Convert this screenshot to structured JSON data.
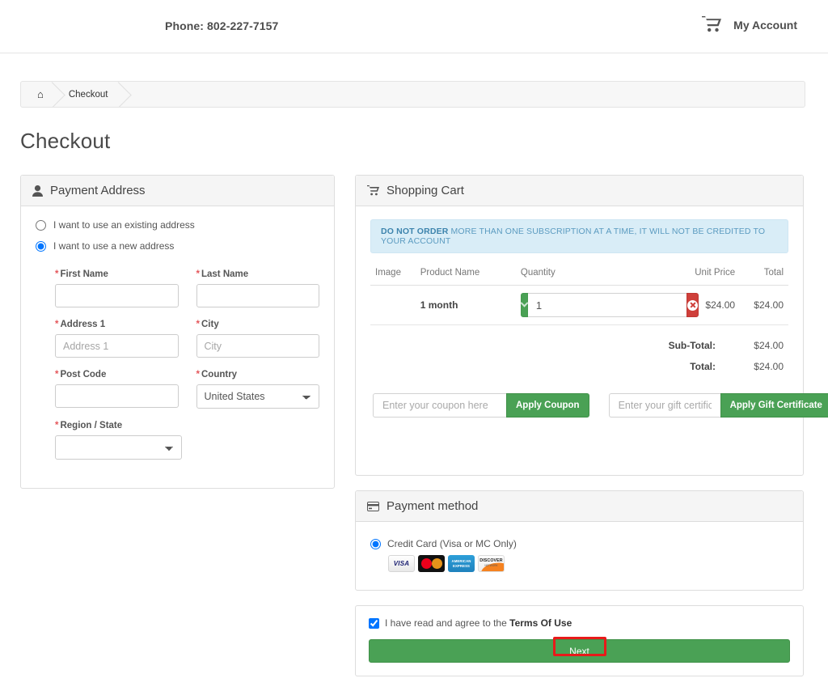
{
  "header": {
    "phone_label": "Phone: 802-227-7157",
    "cart_icon": "shopping-cart-icon",
    "my_account": "My Account"
  },
  "breadcrumb": {
    "home_icon": "home-icon",
    "items": [
      {
        "label": "Checkout"
      }
    ]
  },
  "page_title": "Checkout",
  "payment_address": {
    "panel_icon": "user-icon",
    "panel_title": "Payment Address",
    "options": [
      {
        "label": "I want to use an existing address",
        "selected": false
      },
      {
        "label": "I want to use a new address",
        "selected": true
      }
    ],
    "fields": {
      "first_name": {
        "label": "First Name",
        "required": "*",
        "value": "",
        "placeholder": ""
      },
      "last_name": {
        "label": "Last Name",
        "required": "*",
        "value": "",
        "placeholder": ""
      },
      "address_1": {
        "label": "Address 1",
        "required": "*",
        "value": "",
        "placeholder": "Address 1"
      },
      "city": {
        "label": "City",
        "required": "*",
        "value": "",
        "placeholder": "City"
      },
      "post_code": {
        "label": "Post Code",
        "required": "*",
        "value": "",
        "placeholder": ""
      },
      "country": {
        "label": "Country",
        "required": "*",
        "value": "United States"
      },
      "region_state": {
        "label": "Region / State",
        "required": "*",
        "value": ""
      }
    }
  },
  "shopping_cart": {
    "panel_icon": "cart-icon",
    "panel_title": "Shopping Cart",
    "notice": {
      "strong": "DO NOT ORDER",
      "rest": " MORE THAN ONE SUBSCRIPTION AT A TIME, IT WILL NOT BE CREDITED TO YOUR ACCOUNT"
    },
    "columns": [
      "Image",
      "Product Name",
      "Quantity",
      "Unit Price",
      "Total"
    ],
    "rows": [
      {
        "image": "",
        "product_name": "1 month",
        "quantity": "1",
        "qty_dropdown_icon": "chevron-down-icon",
        "remove_icon": "remove-circle-icon",
        "unit_price": "$24.00",
        "total": "$24.00"
      }
    ],
    "totals": [
      {
        "label": "Sub-Total:",
        "value": "$24.00"
      },
      {
        "label": "Total:",
        "value": "$24.00"
      }
    ],
    "coupon": {
      "placeholder": "Enter your coupon here",
      "value": "",
      "button": "Apply Coupon"
    },
    "gift_certificate": {
      "placeholder": "Enter your gift certificate here",
      "value": "",
      "button": "Apply Gift Certificate"
    }
  },
  "payment_method": {
    "panel_icon": "credit-card-icon",
    "panel_title": "Payment method",
    "options": [
      {
        "label": "Credit Card (Visa or MC Only)",
        "selected": true
      }
    ],
    "cards": [
      {
        "name": "visa-card-icon",
        "label": "VISA"
      },
      {
        "name": "mastercard-card-icon",
        "label": ""
      },
      {
        "name": "amex-card-icon",
        "label": "AMERICAN EXPRESS"
      },
      {
        "name": "discover-card-icon",
        "label": "DISCOVER",
        "sub": "NETWORK"
      }
    ]
  },
  "terms": {
    "checkbox_checked": true,
    "text_before": "I have read and agree to the ",
    "link_text": "Terms Of Use",
    "next_button": "Next"
  },
  "colors": {
    "green": "#4aa155",
    "red": "#cf3f3a",
    "highlight_red": "#e81a1a",
    "info_blue": "#d9edf7",
    "required_red": "#e4565a"
  }
}
